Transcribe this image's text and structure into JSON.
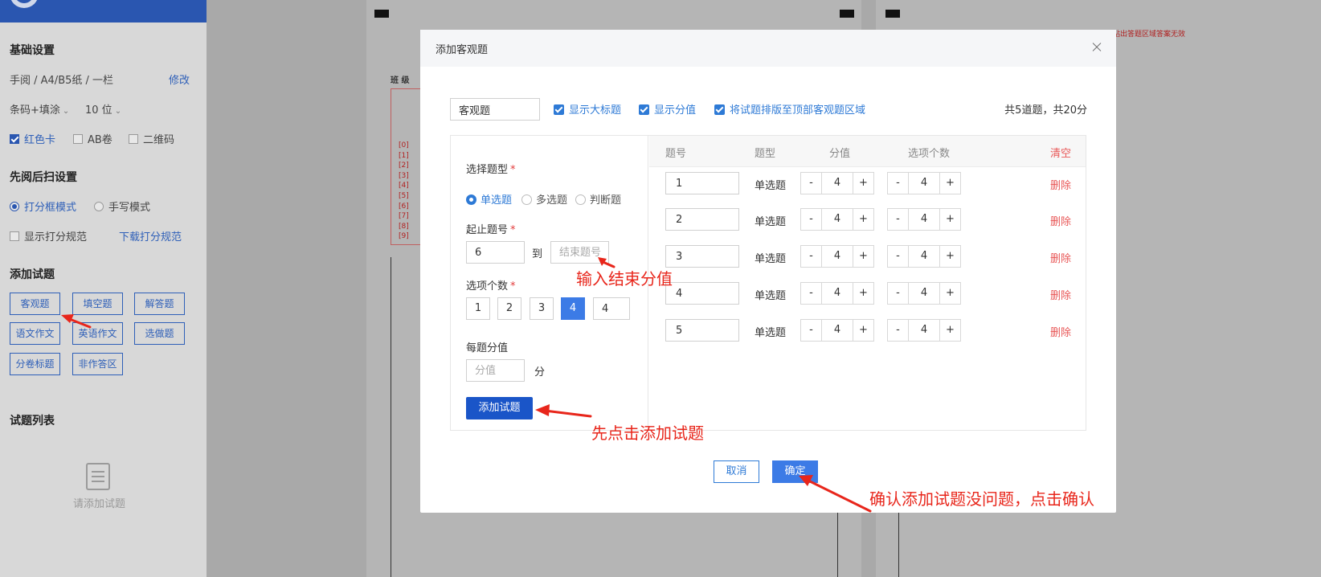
{
  "sidebar": {
    "basic_title": "基础设置",
    "paper_info": "手阅 / A4/B5纸 / 一栏",
    "modify": "修改",
    "barcode_select": "条码+填涂",
    "digits_select": "10 位",
    "checks": [
      {
        "label": "红色卡",
        "checked": true
      },
      {
        "label": "AB卷",
        "checked": false
      },
      {
        "label": "二维码",
        "checked": false
      }
    ],
    "scan_title": "先阅后扫设置",
    "modes": [
      {
        "label": "打分框模式",
        "selected": true
      },
      {
        "label": "手写模式",
        "selected": false
      }
    ],
    "show_rule": "显示打分规范",
    "download_rule": "下载打分规范",
    "add_title": "添加试题",
    "add_buttons": [
      "客观题",
      "填空题",
      "解答题",
      "语文作文",
      "英语作文",
      "选做题",
      "分卷标题",
      "非作答区"
    ],
    "list_title": "试题列表",
    "empty_text": "请添加试题"
  },
  "background": {
    "class_label": "班 级",
    "notice": "贴出答题区域答案无效",
    "bubbles": [
      "[0]",
      "[1]",
      "[2]",
      "[3]",
      "[4]",
      "[5]",
      "[6]",
      "[7]",
      "[8]",
      "[9]"
    ]
  },
  "modal": {
    "title": "添加客观题",
    "name_value": "客观题",
    "options": [
      {
        "label": "显示大标题",
        "checked": true
      },
      {
        "label": "显示分值",
        "checked": true
      },
      {
        "label": "将试题排版至顶部客观题区域",
        "checked": true
      }
    ],
    "summary": "共5道题，共20分",
    "type_label": "选择题型",
    "types": [
      {
        "label": "单选题",
        "selected": true
      },
      {
        "label": "多选题",
        "selected": false
      },
      {
        "label": "判断题",
        "selected": false
      }
    ],
    "range_label": "起止题号",
    "range_start": "6",
    "range_to": "到",
    "range_end_placeholder": "结束题号",
    "count_label": "选项个数",
    "counts": [
      "1",
      "2",
      "3",
      "4"
    ],
    "count_selected": "4",
    "count_input": "4",
    "score_label": "每题分值",
    "score_placeholder": "分值",
    "score_unit": "分",
    "add_button": "添加试题",
    "columns": {
      "no": "题号",
      "type": "题型",
      "score": "分值",
      "options": "选项个数",
      "clear": "清空"
    },
    "rows": [
      {
        "no": "1",
        "type": "单选题",
        "score": "4",
        "options": "4",
        "delete": "删除"
      },
      {
        "no": "2",
        "type": "单选题",
        "score": "4",
        "options": "4",
        "delete": "删除"
      },
      {
        "no": "3",
        "type": "单选题",
        "score": "4",
        "options": "4",
        "delete": "删除"
      },
      {
        "no": "4",
        "type": "单选题",
        "score": "4",
        "options": "4",
        "delete": "删除"
      },
      {
        "no": "5",
        "type": "单选题",
        "score": "4",
        "options": "4",
        "delete": "删除"
      }
    ],
    "minus": "-",
    "plus": "+",
    "cancel": "取消",
    "ok": "确定"
  },
  "annotations": {
    "end_score": "输入结束分值",
    "click_add": "先点击添加试题",
    "confirm": "确认添加试题没问题，点击确认"
  },
  "colors": {
    "primary": "#3c7be6",
    "danger": "#e85656",
    "annotation": "#e8261b",
    "sidebar_topbar": "#2a56b0"
  }
}
